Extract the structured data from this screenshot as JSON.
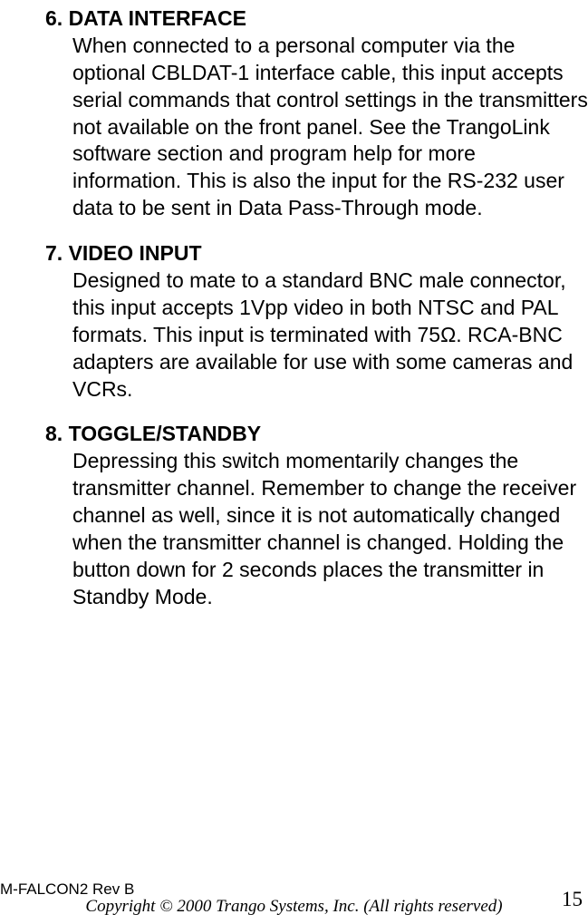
{
  "sections": [
    {
      "heading": "6. DATA INTERFACE",
      "body": "When connected to a personal computer via the optional CBLDAT-1 interface cable, this input accepts serial commands that control settings in the transmitters not available on the front panel.  See the TrangoLink software section and program help for more information.  This is also the input for the RS-232 user data to be sent in Data Pass-Through mode."
    },
    {
      "heading": "7. VIDEO INPUT",
      "body": "Designed to mate to a standard BNC male connector, this input accepts 1Vpp video in both NTSC and PAL formats.  This input is terminated with 75Ω.  RCA-BNC adapters are available for use with some cameras and VCRs."
    },
    {
      "heading": "8. TOGGLE/STANDBY",
      "body": "Depressing this switch momentarily changes the transmitter channel.  Remember to change the receiver channel as well, since it is not automatically changed when the transmitter channel is changed.  Holding the button down for 2 seconds places the transmitter in Standby Mode."
    }
  ],
  "footer": {
    "revision": "M-FALCON2 Rev B",
    "copyright": "Copyright © 2000 Trango Systems, Inc.  (All rights reserved)",
    "page_number": "15"
  }
}
